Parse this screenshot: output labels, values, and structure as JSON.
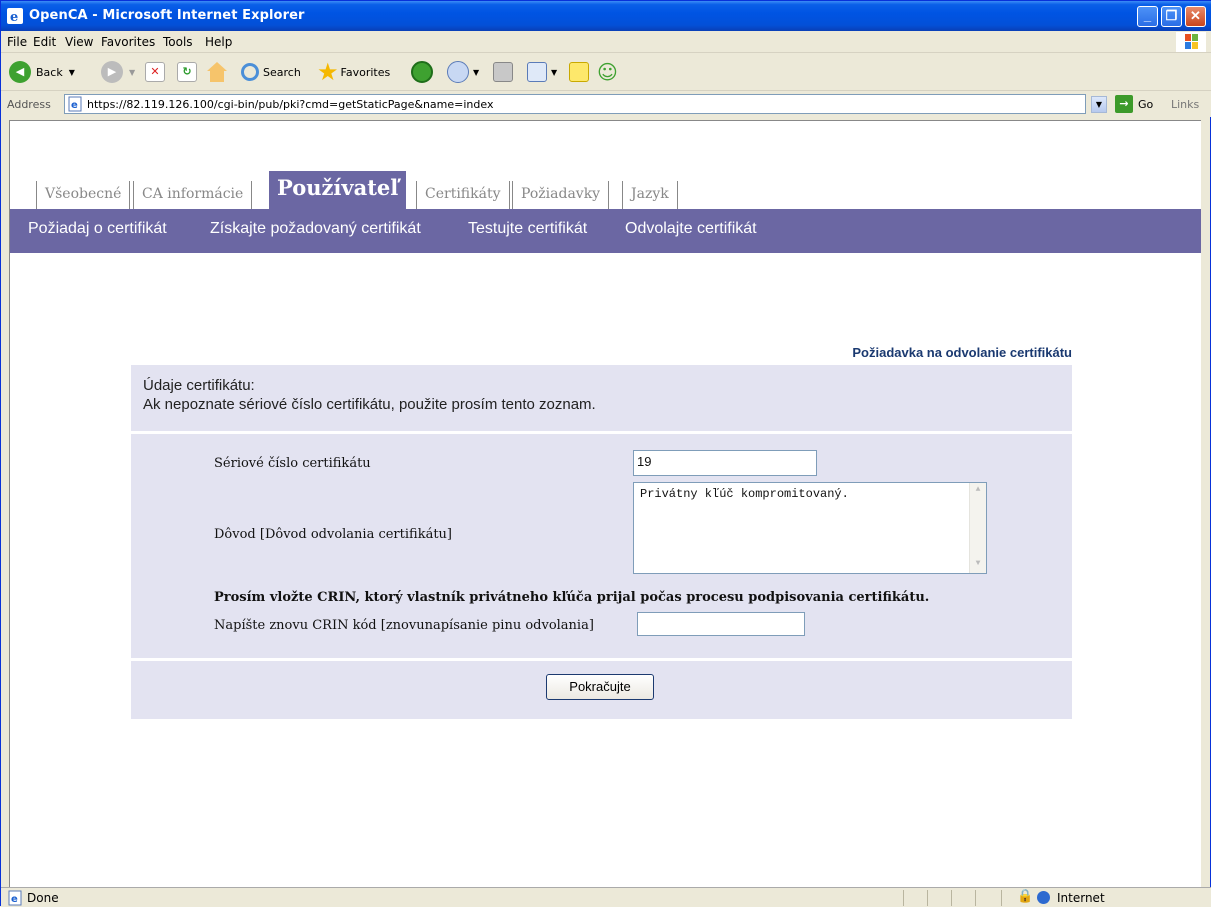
{
  "window": {
    "title": "OpenCA - Microsoft Internet Explorer"
  },
  "menu": [
    "File",
    "Edit",
    "View",
    "Favorites",
    "Tools",
    "Help"
  ],
  "toolbar": {
    "back": "Back",
    "search": "Search",
    "favorites": "Favorites"
  },
  "address": {
    "label": "Address",
    "url": "https://82.119.126.100/cgi-bin/pub/pki?cmd=getStaticPage&name=index",
    "go": "Go",
    "links": "Links"
  },
  "tabs": [
    {
      "label": "Všeobecné"
    },
    {
      "label": "CA informácie"
    },
    {
      "label": "Používateľ"
    },
    {
      "label": "Certifikáty"
    },
    {
      "label": "Požiadavky"
    },
    {
      "label": "Jazyk"
    }
  ],
  "subnav": [
    "Požiadaj o certifikát",
    "Získajte požadovaný certifikát",
    "Testujte certifikát",
    "Odvolajte certifikát"
  ],
  "form": {
    "title": "Požiadavka na odvolanie certifikátu",
    "intro_line1": "Údaje certifikátu:",
    "intro_line2": "Ak nepoznate sériové číslo certifikátu, použite prosím tento zoznam.",
    "serial_label": "Sériové číslo certifikátu",
    "serial_value": "19",
    "reason_label": "Dôvod [Dôvod odvolania certifikátu]",
    "reason_value": "Privátny kľúč kompromitovaný.",
    "crin_notice": "Prosím vložte CRIN, ktorý vlastník privátneho kľúča prijal počas procesu podpisovania certifikátu.",
    "crin_label": "Napíšte znovu CRIN kód [znovunapísanie pinu odvolania]",
    "crin_value": "",
    "submit": "Pokračujte"
  },
  "status": {
    "text": "Done",
    "zone": "Internet"
  }
}
